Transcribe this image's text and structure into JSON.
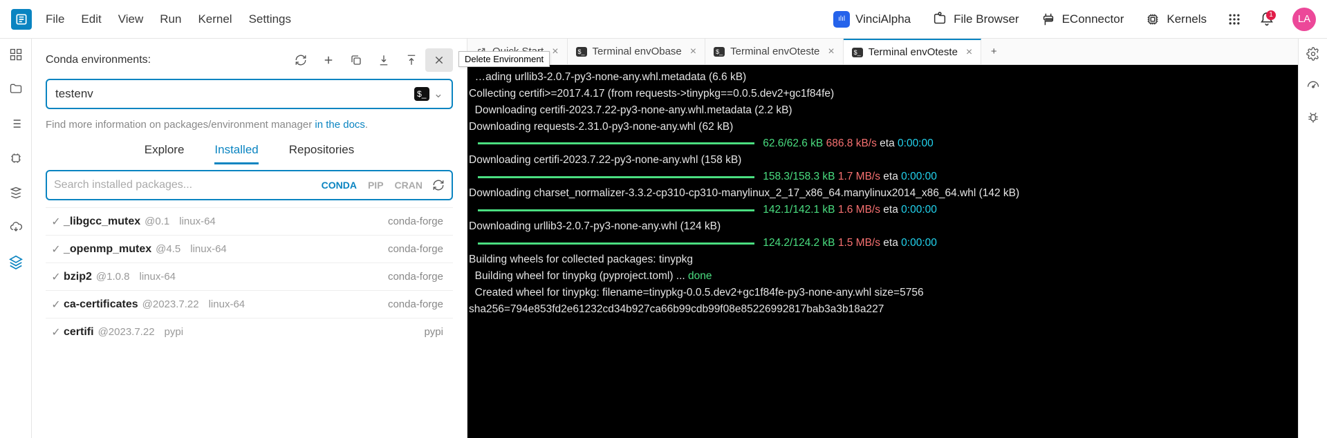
{
  "menu": {
    "items": [
      "File",
      "Edit",
      "View",
      "Run",
      "Kernel",
      "Settings"
    ]
  },
  "shortcuts": [
    {
      "id": "vincialpha",
      "label": "VinciAlpha"
    },
    {
      "id": "file-browser",
      "label": "File Browser"
    },
    {
      "id": "econnector",
      "label": "EConnector"
    },
    {
      "id": "kernels",
      "label": "Kernels"
    }
  ],
  "notifications": {
    "count": "1"
  },
  "avatar": {
    "initials": "LA"
  },
  "conda": {
    "panel_title": "Conda environments:",
    "tooltip_delete": "Delete Environment",
    "selected_env": "testenv",
    "docs_hint_prefix": "Find more information on packages/environment manager ",
    "docs_link_text": "in the docs",
    "docs_hint_suffix": ".",
    "tabs": {
      "explore": "Explore",
      "installed": "Installed",
      "repositories": "Repositories"
    },
    "search_placeholder": "Search installed packages...",
    "filters": {
      "conda": "CONDA",
      "pip": "PIP",
      "cran": "CRAN"
    },
    "packages": [
      {
        "name": "_libgcc_mutex",
        "version": "@0.1",
        "arch": "linux-64",
        "channel": "conda-forge"
      },
      {
        "name": "_openmp_mutex",
        "version": "@4.5",
        "arch": "linux-64",
        "channel": "conda-forge"
      },
      {
        "name": "bzip2",
        "version": "@1.0.8",
        "arch": "linux-64",
        "channel": "conda-forge"
      },
      {
        "name": "ca-certificates",
        "version": "@2023.7.22",
        "arch": "linux-64",
        "channel": "conda-forge"
      },
      {
        "name": "certifi",
        "version": "@2023.7.22",
        "arch": "pypi",
        "channel": "pypi"
      }
    ]
  },
  "tabs": [
    {
      "id": "quick-start",
      "label": "Quick Start",
      "kind": "page"
    },
    {
      "id": "term-envobase",
      "label": "Terminal envObase",
      "kind": "terminal"
    },
    {
      "id": "term-envoteste1",
      "label": "Terminal envOteste",
      "kind": "terminal"
    },
    {
      "id": "term-envoteste2",
      "label": "Terminal envOteste",
      "kind": "terminal",
      "active": true
    }
  ],
  "terminal": {
    "lines": [
      {
        "t": "plain",
        "text": "  …ading urllib3-2.0.7-py3-none-any.whl.metadata (6.6 kB)"
      },
      {
        "t": "plain",
        "text": "Collecting certifi>=2017.4.17 (from requests->tinypkg==0.0.5.dev2+gc1f84fe)"
      },
      {
        "t": "plain",
        "text": "  Downloading certifi-2023.7.22-py3-none-any.whl.metadata (2.2 kB)"
      },
      {
        "t": "plain",
        "text": "Downloading requests-2.31.0-py3-none-any.whl (62 kB)"
      },
      {
        "t": "dl",
        "done": "62.6/62.6 kB",
        "speed": "686.8 kB/s",
        "eta_label": "eta",
        "eta": "0:00:00"
      },
      {
        "t": "plain",
        "text": "Downloading certifi-2023.7.22-py3-none-any.whl (158 kB)"
      },
      {
        "t": "dl",
        "done": "158.3/158.3 kB",
        "speed": "1.7 MB/s",
        "eta_label": "eta",
        "eta": "0:00:00"
      },
      {
        "t": "plain",
        "text": "Downloading charset_normalizer-3.3.2-cp310-cp310-manylinux_2_17_x86_64.manylinux2014_x86_64.whl (142 kB)"
      },
      {
        "t": "dl",
        "done": "142.1/142.1 kB",
        "speed": "1.6 MB/s",
        "eta_label": "eta",
        "eta": "0:00:00"
      },
      {
        "t": "plain",
        "text": "Downloading urllib3-2.0.7-py3-none-any.whl (124 kB)"
      },
      {
        "t": "dl",
        "done": "124.2/124.2 kB",
        "speed": "1.5 MB/s",
        "eta_label": "eta",
        "eta": "0:00:00"
      },
      {
        "t": "plain",
        "text": "Building wheels for collected packages: tinypkg"
      },
      {
        "t": "build",
        "prefix": "  Building wheel for tinypkg (pyproject.toml) ... ",
        "status": "done"
      },
      {
        "t": "plain",
        "text": "  Created wheel for tinypkg: filename=tinypkg-0.0.5.dev2+gc1f84fe-py3-none-any.whl size=5756 sha256=794e853fd2e61232cd34b927ca66b99cdb99f08e85226992817bab3a3b18a227"
      }
    ]
  }
}
